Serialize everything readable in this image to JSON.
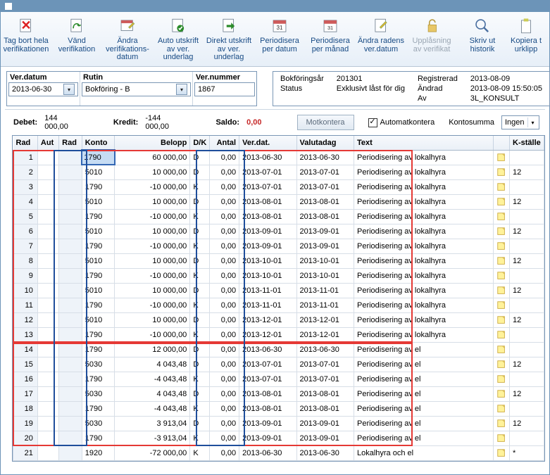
{
  "toolbar": {
    "delete": "Tag bort hela\nverifikationen",
    "reverse": "Vänd\nverifikation",
    "changedate": "Ändra\nverifikations-\ndatum",
    "autoprint": "Auto utskrift\nav ver.\nunderlag",
    "directprint": "Direkt utskrift\nav ver.\nunderlag",
    "periodiseradate": "Periodisera\nper datum",
    "periodiseramonth": "Periodisera\nper månad",
    "changerowdate": "Ändra radens\nver.datum",
    "unlock": "Upplåsning\nav verifikat",
    "history": "Skriv ut\nhistorik",
    "copy": "Kopiera t\nurklipp"
  },
  "form": {
    "verdatum_label": "Ver.datum",
    "verdatum_value": "2013-06-30",
    "rutin_label": "Rutin",
    "rutin_value": "Bokföring - B",
    "vernr_label": "Ver.nummer",
    "vernr_value": "1867"
  },
  "info": {
    "k1": "Bokföringsår",
    "v1": "201301",
    "k4": "Registrerad",
    "v4": "2013-08-09",
    "k2": "Status",
    "v2": "Exklusivt låst för dig",
    "k5": "Ändrad",
    "v5": "2013-08-09 15:50:05",
    "k6": "Av",
    "v6": "3L_KONSULT"
  },
  "sum": {
    "debet_l": "Debet:",
    "debet_v": "144 000,00",
    "kredit_l": "Kredit:",
    "kredit_v": "-144 000,00",
    "saldo_l": "Saldo:",
    "saldo_v": "0,00",
    "mot": "Motkontera",
    "auto": "Automatkontera",
    "ksum": "Kontosumma",
    "ksel": "Ingen"
  },
  "cols": {
    "rad": "Rad",
    "aut": "Aut",
    "rad2": "Rad",
    "konto": "Konto",
    "belopp": "Belopp",
    "dk": "D/K",
    "antal": "Antal",
    "verdat": "Ver.dat.",
    "valuta": "Valutadag",
    "text": "Text",
    "k": "K-ställe"
  },
  "rows": [
    {
      "n": 1,
      "konto": "1790",
      "belopp": "60 000,00",
      "dk": "D",
      "antal": "0,00",
      "verdat": "2013-06-30",
      "valuta": "2013-06-30",
      "text": "Periodisering av lokalhyra",
      "note": true,
      "k": ""
    },
    {
      "n": 2,
      "konto": "5010",
      "belopp": "10 000,00",
      "dk": "D",
      "antal": "0,00",
      "verdat": "2013-07-01",
      "valuta": "2013-07-01",
      "text": "Periodisering av lokalhyra",
      "note": true,
      "k": "12"
    },
    {
      "n": 3,
      "konto": "1790",
      "belopp": "-10 000,00",
      "dk": "K",
      "antal": "0,00",
      "verdat": "2013-07-01",
      "valuta": "2013-07-01",
      "text": "Periodisering av lokalhyra",
      "note": true,
      "k": ""
    },
    {
      "n": 4,
      "konto": "5010",
      "belopp": "10 000,00",
      "dk": "D",
      "antal": "0,00",
      "verdat": "2013-08-01",
      "valuta": "2013-08-01",
      "text": "Periodisering av lokalhyra",
      "note": true,
      "k": "12"
    },
    {
      "n": 5,
      "konto": "1790",
      "belopp": "-10 000,00",
      "dk": "K",
      "antal": "0,00",
      "verdat": "2013-08-01",
      "valuta": "2013-08-01",
      "text": "Periodisering av lokalhyra",
      "note": true,
      "k": ""
    },
    {
      "n": 6,
      "konto": "5010",
      "belopp": "10 000,00",
      "dk": "D",
      "antal": "0,00",
      "verdat": "2013-09-01",
      "valuta": "2013-09-01",
      "text": "Periodisering av lokalhyra",
      "note": true,
      "k": "12"
    },
    {
      "n": 7,
      "konto": "1790",
      "belopp": "-10 000,00",
      "dk": "K",
      "antal": "0,00",
      "verdat": "2013-09-01",
      "valuta": "2013-09-01",
      "text": "Periodisering av lokalhyra",
      "note": true,
      "k": ""
    },
    {
      "n": 8,
      "konto": "5010",
      "belopp": "10 000,00",
      "dk": "D",
      "antal": "0,00",
      "verdat": "2013-10-01",
      "valuta": "2013-10-01",
      "text": "Periodisering av lokalhyra",
      "note": true,
      "k": "12"
    },
    {
      "n": 9,
      "konto": "1790",
      "belopp": "-10 000,00",
      "dk": "K",
      "antal": "0,00",
      "verdat": "2013-10-01",
      "valuta": "2013-10-01",
      "text": "Periodisering av lokalhyra",
      "note": true,
      "k": ""
    },
    {
      "n": 10,
      "konto": "5010",
      "belopp": "10 000,00",
      "dk": "D",
      "antal": "0,00",
      "verdat": "2013-11-01",
      "valuta": "2013-11-01",
      "text": "Periodisering av lokalhyra",
      "note": true,
      "k": "12"
    },
    {
      "n": 11,
      "konto": "1790",
      "belopp": "-10 000,00",
      "dk": "K",
      "antal": "0,00",
      "verdat": "2013-11-01",
      "valuta": "2013-11-01",
      "text": "Periodisering av lokalhyra",
      "note": true,
      "k": ""
    },
    {
      "n": 12,
      "konto": "5010",
      "belopp": "10 000,00",
      "dk": "D",
      "antal": "0,00",
      "verdat": "2013-12-01",
      "valuta": "2013-12-01",
      "text": "Periodisering av lokalhyra",
      "note": true,
      "k": "12"
    },
    {
      "n": 13,
      "konto": "1790",
      "belopp": "-10 000,00",
      "dk": "K",
      "antal": "0,00",
      "verdat": "2013-12-01",
      "valuta": "2013-12-01",
      "text": "Periodisering av lokalhyra",
      "note": true,
      "k": ""
    },
    {
      "n": 14,
      "konto": "1790",
      "belopp": "12 000,00",
      "dk": "D",
      "antal": "0,00",
      "verdat": "2013-06-30",
      "valuta": "2013-06-30",
      "text": "Periodisering av el",
      "note": true,
      "k": ""
    },
    {
      "n": 15,
      "konto": "5030",
      "belopp": "4 043,48",
      "dk": "D",
      "antal": "0,00",
      "verdat": "2013-07-01",
      "valuta": "2013-07-01",
      "text": "Periodisering av el",
      "note": true,
      "k": "12"
    },
    {
      "n": 16,
      "konto": "1790",
      "belopp": "-4 043,48",
      "dk": "K",
      "antal": "0,00",
      "verdat": "2013-07-01",
      "valuta": "2013-07-01",
      "text": "Periodisering av el",
      "note": true,
      "k": ""
    },
    {
      "n": 17,
      "konto": "5030",
      "belopp": "4 043,48",
      "dk": "D",
      "antal": "0,00",
      "verdat": "2013-08-01",
      "valuta": "2013-08-01",
      "text": "Periodisering av el",
      "note": true,
      "k": "12"
    },
    {
      "n": 18,
      "konto": "1790",
      "belopp": "-4 043,48",
      "dk": "K",
      "antal": "0,00",
      "verdat": "2013-08-01",
      "valuta": "2013-08-01",
      "text": "Periodisering av el",
      "note": true,
      "k": ""
    },
    {
      "n": 19,
      "konto": "5030",
      "belopp": "3 913,04",
      "dk": "D",
      "antal": "0,00",
      "verdat": "2013-09-01",
      "valuta": "2013-09-01",
      "text": "Periodisering av el",
      "note": true,
      "k": "12"
    },
    {
      "n": 20,
      "konto": "1790",
      "belopp": "-3 913,04",
      "dk": "K",
      "antal": "0,00",
      "verdat": "2013-09-01",
      "valuta": "2013-09-01",
      "text": "Periodisering av el",
      "note": true,
      "k": ""
    },
    {
      "n": 21,
      "konto": "1920",
      "belopp": "-72 000,00",
      "dk": "K",
      "antal": "0,00",
      "verdat": "2013-06-30",
      "valuta": "2013-06-30",
      "text": "Lokalhyra och el",
      "note": true,
      "k": "*"
    }
  ]
}
